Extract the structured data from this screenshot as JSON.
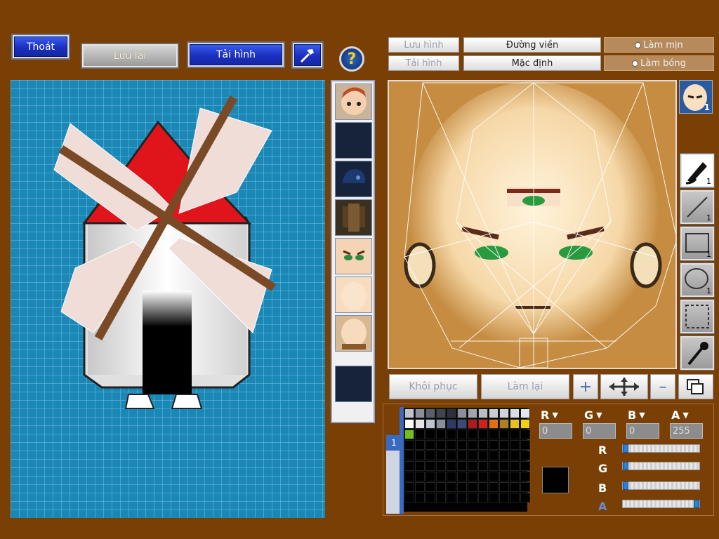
{
  "toolbar_left": {
    "exit_label": "Thoát",
    "save_label": "Lưu lại",
    "reload_label": "Tải hình",
    "help_icon": "question-icon",
    "hammer_icon": "hammer-icon"
  },
  "toolbar_right": {
    "save_image_label": "Lưu hình",
    "load_image_label": "Tải hình",
    "outline_label": "Đường viền",
    "default_label": "Mặc định",
    "smooth_label": "Làm mịn",
    "shine_label": "Làm bóng"
  },
  "thumbnails": [
    {
      "name": "character-head",
      "slot_count": ""
    },
    {
      "name": "empty-slot"
    },
    {
      "name": "helmet"
    },
    {
      "name": "armor"
    },
    {
      "name": "face-eyes"
    },
    {
      "name": "face-plain"
    },
    {
      "name": "face-blank"
    },
    {
      "name": "empty-slot"
    }
  ],
  "head_preview": {
    "badge": "1"
  },
  "tools": [
    {
      "name": "brush-tool",
      "count": "1"
    },
    {
      "name": "line-tool",
      "count": "1"
    },
    {
      "name": "rectangle-tool",
      "count": "1"
    },
    {
      "name": "ellipse-tool",
      "count": "1"
    },
    {
      "name": "selection-tool",
      "count": ""
    },
    {
      "name": "eyedropper-tool",
      "count": ""
    }
  ],
  "bottom_buttons": {
    "restore_label": "Khôi phục",
    "redo_label": "Làm lại"
  },
  "color_channels": {
    "r_label": "R",
    "g_label": "G",
    "b_label": "B",
    "a_label": "A",
    "r_value": "0",
    "g_value": "0",
    "b_value": "0",
    "a_value": "255"
  },
  "sliders": {
    "r": 0,
    "g": 0,
    "b": 0,
    "a": 1
  },
  "palette_tab": "1",
  "current_color": "#000000",
  "palette_colors": [
    "#bfc3cc",
    "#8a8f99",
    "#5a5f69",
    "#40444e",
    "#2c3038",
    "#8a8f99",
    "#a0a4ad",
    "#b8bcc4",
    "#c8ccd4",
    "#d0d4dc",
    "#d8dce4",
    "#e4e8ee",
    "#ffffff",
    "#e6e6e6",
    "#c0c4cc",
    "#8a8f99",
    "#2c3a66",
    "#3c4a7a",
    "#b01a1a",
    "#d02020",
    "#e07010",
    "#b08020",
    "#e8c020",
    "#f0d010",
    "#70c020"
  ]
}
